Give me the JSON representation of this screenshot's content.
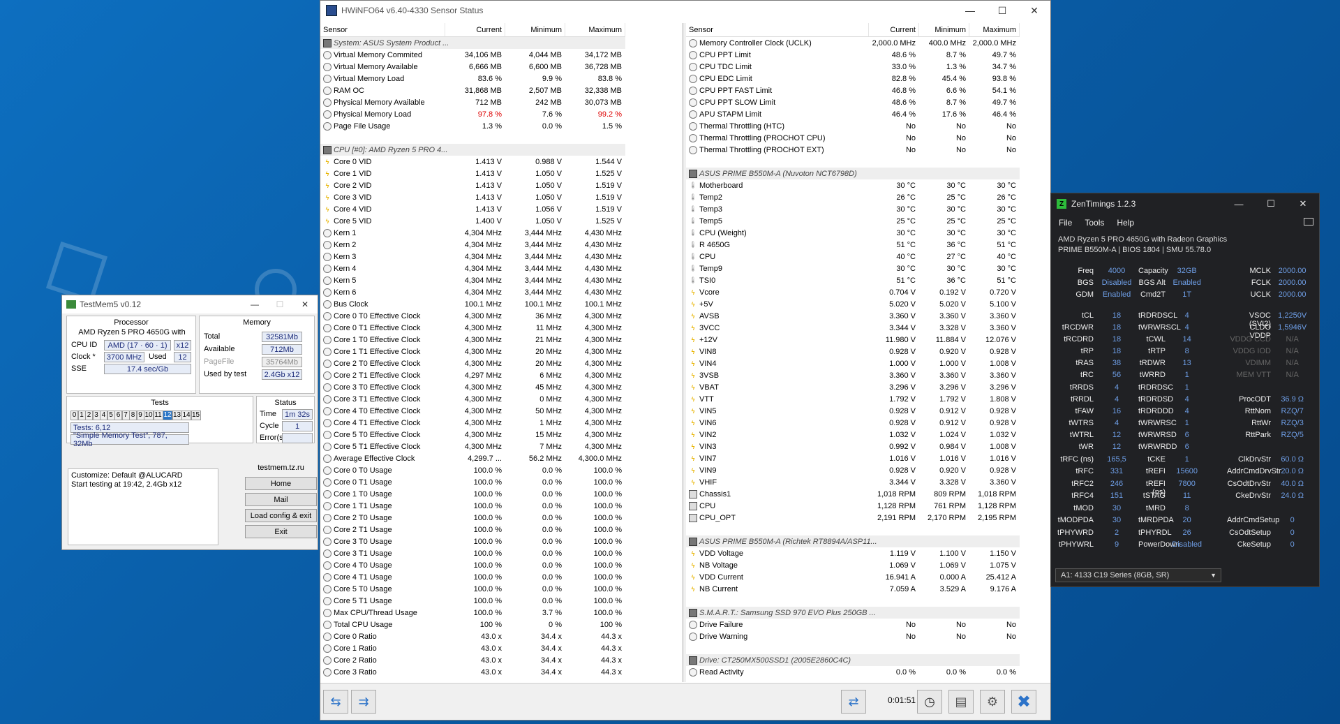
{
  "hwinfo": {
    "title": "HWiNFO64 v6.40-4330 Sensor Status",
    "headers": [
      "Sensor",
      "Current",
      "Minimum",
      "Maximum"
    ],
    "timer": "0:01:51",
    "left_rows": [
      {
        "t": "group",
        "n": "System: ASUS System Product ..."
      },
      {
        "i": "circle",
        "n": "Virtual Memory Commited",
        "c": "34,106 MB",
        "mi": "4,044 MB",
        "ma": "34,172 MB"
      },
      {
        "i": "circle",
        "n": "Virtual Memory Available",
        "c": "6,666 MB",
        "mi": "6,600 MB",
        "ma": "36,728 MB"
      },
      {
        "i": "circle",
        "n": "Virtual Memory Load",
        "c": "83.6 %",
        "mi": "9.9 %",
        "ma": "83.8 %"
      },
      {
        "i": "circle",
        "n": " RAM  OC",
        "c": "31,868 MB",
        "mi": "2,507 MB",
        "ma": "32,338 MB"
      },
      {
        "i": "circle",
        "n": "Physical Memory Available",
        "c": "712 MB",
        "mi": "242 MB",
        "ma": "30,073 MB"
      },
      {
        "i": "circle",
        "n": "Physical Memory Load",
        "c": "97.8 %",
        "mi": "7.6 %",
        "ma": "99.2 %",
        "red": true
      },
      {
        "i": "circle",
        "n": "Page File Usage",
        "c": "1.3 %",
        "mi": "0.0 %",
        "ma": "1.5 %"
      },
      {
        "t": "blank"
      },
      {
        "t": "group",
        "n": "CPU [#0]: AMD Ryzen 5 PRO 4..."
      },
      {
        "i": "bolt",
        "n": "Core 0 VID",
        "c": "1.413 V",
        "mi": "0.988 V",
        "ma": "1.544 V"
      },
      {
        "i": "bolt",
        "n": "Core 1 VID",
        "c": "1.413 V",
        "mi": "1.050 V",
        "ma": "1.525 V"
      },
      {
        "i": "bolt",
        "n": "Core 2 VID",
        "c": "1.413 V",
        "mi": "1.050 V",
        "ma": "1.519 V"
      },
      {
        "i": "bolt",
        "n": "Core 3 VID",
        "c": "1.413 V",
        "mi": "1.050 V",
        "ma": "1.519 V"
      },
      {
        "i": "bolt",
        "n": "Core 4 VID",
        "c": "1.413 V",
        "mi": "1.056 V",
        "ma": "1.519 V"
      },
      {
        "i": "bolt",
        "n": "Core 5 VID",
        "c": "1.400 V",
        "mi": "1.050 V",
        "ma": "1.525 V"
      },
      {
        "i": "circle",
        "n": "Kern 1",
        "c": "4,304 MHz",
        "mi": "3,444 MHz",
        "ma": "4,430 MHz"
      },
      {
        "i": "circle",
        "n": "Kern 2",
        "c": "4,304 MHz",
        "mi": "3,444 MHz",
        "ma": "4,430 MHz"
      },
      {
        "i": "circle",
        "n": "Kern 3",
        "c": "4,304 MHz",
        "mi": "3,444 MHz",
        "ma": "4,430 MHz"
      },
      {
        "i": "circle",
        "n": "Kern 4",
        "c": "4,304 MHz",
        "mi": "3,444 MHz",
        "ma": "4,430 MHz"
      },
      {
        "i": "circle",
        "n": "Kern 5",
        "c": "4,304 MHz",
        "mi": "3,444 MHz",
        "ma": "4,430 MHz"
      },
      {
        "i": "circle",
        "n": "Kern 6",
        "c": "4,304 MHz",
        "mi": "3,444 MHz",
        "ma": "4,430 MHz"
      },
      {
        "i": "circle",
        "n": "Bus Clock",
        "c": "100.1 MHz",
        "mi": "100.1 MHz",
        "ma": "100.1 MHz"
      },
      {
        "i": "circle",
        "n": "Core 0 T0 Effective Clock",
        "c": "4,300 MHz",
        "mi": "36 MHz",
        "ma": "4,300 MHz"
      },
      {
        "i": "circle",
        "n": "Core 0 T1 Effective Clock",
        "c": "4,300 MHz",
        "mi": "11 MHz",
        "ma": "4,300 MHz"
      },
      {
        "i": "circle",
        "n": "Core 1 T0 Effective Clock",
        "c": "4,300 MHz",
        "mi": "21 MHz",
        "ma": "4,300 MHz"
      },
      {
        "i": "circle",
        "n": "Core 1 T1 Effective Clock",
        "c": "4,300 MHz",
        "mi": "20 MHz",
        "ma": "4,300 MHz"
      },
      {
        "i": "circle",
        "n": "Core 2 T0 Effective Clock",
        "c": "4,300 MHz",
        "mi": "20 MHz",
        "ma": "4,300 MHz"
      },
      {
        "i": "circle",
        "n": "Core 2 T1 Effective Clock",
        "c": "4,297 MHz",
        "mi": "6 MHz",
        "ma": "4,300 MHz"
      },
      {
        "i": "circle",
        "n": "Core 3 T0 Effective Clock",
        "c": "4,300 MHz",
        "mi": "45 MHz",
        "ma": "4,300 MHz"
      },
      {
        "i": "circle",
        "n": "Core 3 T1 Effective Clock",
        "c": "4,300 MHz",
        "mi": "0 MHz",
        "ma": "4,300 MHz"
      },
      {
        "i": "circle",
        "n": "Core 4 T0 Effective Clock",
        "c": "4,300 MHz",
        "mi": "50 MHz",
        "ma": "4,300 MHz"
      },
      {
        "i": "circle",
        "n": "Core 4 T1 Effective Clock",
        "c": "4,300 MHz",
        "mi": "1 MHz",
        "ma": "4,300 MHz"
      },
      {
        "i": "circle",
        "n": "Core 5 T0 Effective Clock",
        "c": "4,300 MHz",
        "mi": "15 MHz",
        "ma": "4,300 MHz"
      },
      {
        "i": "circle",
        "n": "Core 5 T1 Effective Clock",
        "c": "4,300 MHz",
        "mi": "7 MHz",
        "ma": "4,300 MHz"
      },
      {
        "i": "circle",
        "n": "Average Effective Clock",
        "c": "4,299.7 ...",
        "mi": "56.2 MHz",
        "ma": "4,300.0 MHz"
      },
      {
        "i": "circle",
        "n": "Core 0 T0 Usage",
        "c": "100.0 %",
        "mi": "0.0 %",
        "ma": "100.0 %"
      },
      {
        "i": "circle",
        "n": "Core 0 T1 Usage",
        "c": "100.0 %",
        "mi": "0.0 %",
        "ma": "100.0 %"
      },
      {
        "i": "circle",
        "n": "Core 1 T0 Usage",
        "c": "100.0 %",
        "mi": "0.0 %",
        "ma": "100.0 %"
      },
      {
        "i": "circle",
        "n": "Core 1 T1 Usage",
        "c": "100.0 %",
        "mi": "0.0 %",
        "ma": "100.0 %"
      },
      {
        "i": "circle",
        "n": "Core 2 T0 Usage",
        "c": "100.0 %",
        "mi": "0.0 %",
        "ma": "100.0 %"
      },
      {
        "i": "circle",
        "n": "Core 2 T1 Usage",
        "c": "100.0 %",
        "mi": "0.0 %",
        "ma": "100.0 %"
      },
      {
        "i": "circle",
        "n": "Core 3 T0 Usage",
        "c": "100.0 %",
        "mi": "0.0 %",
        "ma": "100.0 %"
      },
      {
        "i": "circle",
        "n": "Core 3 T1 Usage",
        "c": "100.0 %",
        "mi": "0.0 %",
        "ma": "100.0 %"
      },
      {
        "i": "circle",
        "n": "Core 4 T0 Usage",
        "c": "100.0 %",
        "mi": "0.0 %",
        "ma": "100.0 %"
      },
      {
        "i": "circle",
        "n": "Core 4 T1 Usage",
        "c": "100.0 %",
        "mi": "0.0 %",
        "ma": "100.0 %"
      },
      {
        "i": "circle",
        "n": "Core 5 T0 Usage",
        "c": "100.0 %",
        "mi": "0.0 %",
        "ma": "100.0 %"
      },
      {
        "i": "circle",
        "n": "Core 5 T1 Usage",
        "c": "100.0 %",
        "mi": "0.0 %",
        "ma": "100.0 %"
      },
      {
        "i": "circle",
        "n": "Max CPU/Thread Usage",
        "c": "100.0 %",
        "mi": "3.7 %",
        "ma": "100.0 %"
      },
      {
        "i": "circle",
        "n": "Total CPU Usage",
        "c": "100 %",
        "mi": "0 %",
        "ma": "100 %"
      },
      {
        "i": "circle",
        "n": "Core 0 Ratio",
        "c": "43.0 x",
        "mi": "34.4 x",
        "ma": "44.3 x"
      },
      {
        "i": "circle",
        "n": "Core 1 Ratio",
        "c": "43.0 x",
        "mi": "34.4 x",
        "ma": "44.3 x"
      },
      {
        "i": "circle",
        "n": "Core 2 Ratio",
        "c": "43.0 x",
        "mi": "34.4 x",
        "ma": "44.3 x"
      },
      {
        "i": "circle",
        "n": "Core 3 Ratio",
        "c": "43.0 x",
        "mi": "34.4 x",
        "ma": "44.3 x"
      }
    ],
    "right_rows": [
      {
        "i": "circle",
        "n": "Memory Controller Clock (UCLK)",
        "c": "2,000.0 MHz",
        "mi": "400.0 MHz",
        "ma": "2,000.0 MHz"
      },
      {
        "i": "circle",
        "n": "CPU PPT Limit",
        "c": "48.6 %",
        "mi": "8.7 %",
        "ma": "49.7 %"
      },
      {
        "i": "circle",
        "n": "CPU TDC Limit",
        "c": "33.0 %",
        "mi": "1.3 %",
        "ma": "34.7 %"
      },
      {
        "i": "circle",
        "n": "CPU EDC Limit",
        "c": "82.8 %",
        "mi": "45.4 %",
        "ma": "93.8 %"
      },
      {
        "i": "circle",
        "n": "CPU PPT FAST Limit",
        "c": "46.8 %",
        "mi": "6.6 %",
        "ma": "54.1 %"
      },
      {
        "i": "circle",
        "n": "CPU PPT SLOW Limit",
        "c": "48.6 %",
        "mi": "8.7 %",
        "ma": "49.7 %"
      },
      {
        "i": "circle",
        "n": "APU STAPM Limit",
        "c": "46.4 %",
        "mi": "17.6 %",
        "ma": "46.4 %"
      },
      {
        "i": "circle",
        "n": "Thermal Throttling (HTC)",
        "c": "No",
        "mi": "No",
        "ma": "No"
      },
      {
        "i": "circle",
        "n": "Thermal Throttling (PROCHOT CPU)",
        "c": "No",
        "mi": "No",
        "ma": "No"
      },
      {
        "i": "circle",
        "n": "Thermal Throttling (PROCHOT EXT)",
        "c": "No",
        "mi": "No",
        "ma": "No"
      },
      {
        "t": "blank"
      },
      {
        "t": "group",
        "n": "ASUS PRIME B550M-A (Nuvoton NCT6798D)"
      },
      {
        "i": "therm",
        "n": "Motherboard",
        "c": "30 °C",
        "mi": "30 °C",
        "ma": "30 °C"
      },
      {
        "i": "therm",
        "n": "Temp2",
        "c": "26 °C",
        "mi": "25 °C",
        "ma": "26 °C"
      },
      {
        "i": "therm",
        "n": "Temp3",
        "c": "30 °C",
        "mi": "30 °C",
        "ma": "30 °C"
      },
      {
        "i": "therm",
        "n": "Temp5",
        "c": "25 °C",
        "mi": "25 °C",
        "ma": "25 °C"
      },
      {
        "i": "therm",
        "n": "CPU (Weight)",
        "c": "30 °C",
        "mi": "30 °C",
        "ma": "30 °C"
      },
      {
        "i": "therm",
        "n": " R 4650G",
        "c": "51 °C",
        "mi": "36 °C",
        "ma": "51 °C"
      },
      {
        "i": "therm",
        "n": "CPU",
        "c": "40 °C",
        "mi": "27 °C",
        "ma": "40 °C"
      },
      {
        "i": "therm",
        "n": "Temp9",
        "c": "30 °C",
        "mi": "30 °C",
        "ma": "30 °C"
      },
      {
        "i": "therm",
        "n": "TSI0",
        "c": "51 °C",
        "mi": "36 °C",
        "ma": "51 °C"
      },
      {
        "i": "bolt",
        "n": "Vcore",
        "c": "0.704 V",
        "mi": "0.192 V",
        "ma": "0.720 V"
      },
      {
        "i": "bolt",
        "n": "+5V",
        "c": "5.020 V",
        "mi": "5.020 V",
        "ma": "5.100 V"
      },
      {
        "i": "bolt",
        "n": "AVSB",
        "c": "3.360 V",
        "mi": "3.360 V",
        "ma": "3.360 V"
      },
      {
        "i": "bolt",
        "n": "3VCC",
        "c": "3.344 V",
        "mi": "3.328 V",
        "ma": "3.360 V"
      },
      {
        "i": "bolt",
        "n": "+12V",
        "c": "11.980 V",
        "mi": "11.884 V",
        "ma": "12.076 V"
      },
      {
        "i": "bolt",
        "n": "VIN8",
        "c": "0.928 V",
        "mi": "0.920 V",
        "ma": "0.928 V"
      },
      {
        "i": "bolt",
        "n": "VIN4",
        "c": "1.000 V",
        "mi": "1.000 V",
        "ma": "1.008 V"
      },
      {
        "i": "bolt",
        "n": "3VSB",
        "c": "3.360 V",
        "mi": "3.360 V",
        "ma": "3.360 V"
      },
      {
        "i": "bolt",
        "n": "VBAT",
        "c": "3.296 V",
        "mi": "3.296 V",
        "ma": "3.296 V"
      },
      {
        "i": "bolt",
        "n": "VTT",
        "c": "1.792 V",
        "mi": "1.792 V",
        "ma": "1.808 V"
      },
      {
        "i": "bolt",
        "n": "VIN5",
        "c": "0.928 V",
        "mi": "0.912 V",
        "ma": "0.928 V"
      },
      {
        "i": "bolt",
        "n": "VIN6",
        "c": "0.928 V",
        "mi": "0.912 V",
        "ma": "0.928 V"
      },
      {
        "i": "bolt",
        "n": "VIN2",
        "c": "1.032 V",
        "mi": "1.024 V",
        "ma": "1.032 V"
      },
      {
        "i": "bolt",
        "n": "VIN3",
        "c": "0.992 V",
        "mi": "0.984 V",
        "ma": "1.008 V"
      },
      {
        "i": "bolt",
        "n": "VIN7",
        "c": "1.016 V",
        "mi": "1.016 V",
        "ma": "1.016 V"
      },
      {
        "i": "bolt",
        "n": "VIN9",
        "c": "0.928 V",
        "mi": "0.920 V",
        "ma": "0.928 V"
      },
      {
        "i": "bolt",
        "n": "VHIF",
        "c": "3.344 V",
        "mi": "3.328 V",
        "ma": "3.360 V"
      },
      {
        "i": "fan",
        "n": "Chassis1",
        "c": "1,018 RPM",
        "mi": "809 RPM",
        "ma": "1,018 RPM"
      },
      {
        "i": "fan",
        "n": "CPU",
        "c": "1,128 RPM",
        "mi": "761 RPM",
        "ma": "1,128 RPM"
      },
      {
        "i": "fan",
        "n": "CPU_OPT",
        "c": "2,191 RPM",
        "mi": "2,170 RPM",
        "ma": "2,195 RPM"
      },
      {
        "t": "blank"
      },
      {
        "t": "group",
        "n": "ASUS PRIME B550M-A (Richtek RT8894A/ASP11..."
      },
      {
        "i": "bolt",
        "n": "VDD Voltage",
        "c": "1.119 V",
        "mi": "1.100 V",
        "ma": "1.150 V"
      },
      {
        "i": "bolt",
        "n": "NB Voltage",
        "c": "1.069 V",
        "mi": "1.069 V",
        "ma": "1.075 V"
      },
      {
        "i": "bolt",
        "n": "VDD Current",
        "c": "16.941 A",
        "mi": "0.000 A",
        "ma": "25.412 A"
      },
      {
        "i": "bolt",
        "n": "NB Current",
        "c": "7.059 A",
        "mi": "3.529 A",
        "ma": "9.176 A"
      },
      {
        "t": "blank"
      },
      {
        "t": "group",
        "n": "S.M.A.R.T.: Samsung SSD 970 EVO Plus 250GB ..."
      },
      {
        "i": "circle",
        "n": "Drive Failure",
        "c": "No",
        "mi": "No",
        "ma": "No"
      },
      {
        "i": "circle",
        "n": "Drive Warning",
        "c": "No",
        "mi": "No",
        "ma": "No"
      },
      {
        "t": "blank"
      },
      {
        "t": "group",
        "n": "Drive: CT250MX500SSD1 (2005E2860C4C)"
      },
      {
        "i": "circle",
        "n": "Read Activity",
        "c": "0.0 %",
        "mi": "0.0 %",
        "ma": "0.0 %"
      }
    ]
  },
  "testmem": {
    "title": "TestMem5 v0.12",
    "processor_title": "Processor",
    "cpu_name": "AMD Ryzen 5 PRO 4650G with",
    "cpu_id_label": "CPU ID",
    "cpu_id": "AMD  (17 · 60 · 1)",
    "cpu_id_x": "x12",
    "clock_label": "Clock *",
    "clock": "3700 MHz",
    "used_label": "Used",
    "used": "12",
    "sse_label": "SSE",
    "sse": "17.4 sec/Gb",
    "memory_title": "Memory",
    "total_label": "Total",
    "total": "32581Mb",
    "avail_label": "Available",
    "avail": "712Mb",
    "pagefile_label": "PageFile",
    "pagefile": "35764Mb",
    "usedby_label": "Used by test",
    "usedby": "2.4Gb x12",
    "tests_title": "Tests",
    "test_numbers": [
      "0",
      "1",
      "2",
      "3",
      "4",
      "5",
      "6",
      "7",
      "8",
      "9",
      "10",
      "11",
      "12",
      "13",
      "14",
      "15"
    ],
    "tests_line": "Tests: 6,12",
    "tests_desc": "\"Simple Memory Test\", 787, 32Mb",
    "status_title": "Status",
    "time_label": "Time",
    "time": "1m 32s",
    "cycle_label": "Cycle",
    "cycle": "1",
    "errors_label": "Error(s)",
    "errors": "",
    "log": [
      "Customize: Default @ALUCARD",
      "Start testing at 19:42, 2.4Gb x12"
    ],
    "site": "testmem.tz.ru",
    "btn_home": "Home",
    "btn_mail": "Mail",
    "btn_load": "Load config & exit",
    "btn_exit": "Exit"
  },
  "zen": {
    "title": "ZenTimings 1.2.3",
    "menu": [
      "File",
      "Tools",
      "Help"
    ],
    "cpu": "AMD Ryzen 5 PRO 4650G with Radeon Graphics",
    "board": "PRIME B550M-A | BIOS 1804 | SMU 55.78.0",
    "col1": [
      [
        "Freq",
        "4000"
      ],
      [
        "BGS",
        "Disabled"
      ],
      [
        "GDM",
        "Enabled"
      ],
      [
        "",
        ""
      ],
      [
        "tCL",
        "18"
      ],
      [
        "tRCDWR",
        "18"
      ],
      [
        "tRCDRD",
        "18"
      ],
      [
        "tRP",
        "18"
      ],
      [
        "tRAS",
        "38"
      ],
      [
        "tRC",
        "56"
      ],
      [
        "tRRDS",
        "4"
      ],
      [
        "tRRDL",
        "4"
      ],
      [
        "tFAW",
        "16"
      ],
      [
        "tWTRS",
        "4"
      ],
      [
        "tWTRL",
        "12"
      ],
      [
        "tWR",
        "12"
      ],
      [
        "tRFC (ns)",
        "165,5"
      ],
      [
        "tRFC",
        "331"
      ],
      [
        "tRFC2",
        "246"
      ],
      [
        "tRFC4",
        "151"
      ],
      [
        "tMOD",
        "30"
      ],
      [
        "tMODPDA",
        "30"
      ],
      [
        "tPHYWRD",
        "2"
      ],
      [
        "tPHYWRL",
        "9"
      ]
    ],
    "col2": [
      [
        "Capacity",
        "32GB"
      ],
      [
        "BGS Alt",
        "Enabled"
      ],
      [
        "Cmd2T",
        "1T"
      ],
      [
        "",
        ""
      ],
      [
        "tRDRDSCL",
        "4"
      ],
      [
        "tWRWRSCL",
        "4"
      ],
      [
        "tCWL",
        "14"
      ],
      [
        "tRTP",
        "8"
      ],
      [
        "tRDWR",
        "13"
      ],
      [
        "tWRRD",
        "1"
      ],
      [
        "tRDRDSC",
        "1"
      ],
      [
        "tRDRDSD",
        "4"
      ],
      [
        "tRDRDDD",
        "4"
      ],
      [
        "tWRWRSC",
        "1"
      ],
      [
        "tWRWRSD",
        "6"
      ],
      [
        "tWRWRDD",
        "6"
      ],
      [
        "tCKE",
        "1"
      ],
      [
        "tREFI",
        "15600"
      ],
      [
        "tREFI (ns)",
        "7800"
      ],
      [
        "tSTAG",
        "11"
      ],
      [
        "tMRD",
        "8"
      ],
      [
        "tMRDPDA",
        "20"
      ],
      [
        "tPHYRDL",
        "26"
      ],
      [
        "PowerDown",
        "Disabled"
      ]
    ],
    "col3": [
      [
        "MCLK",
        "2000.00"
      ],
      [
        "FCLK",
        "2000.00"
      ],
      [
        "UCLK",
        "2000.00"
      ],
      [
        "",
        ""
      ],
      [
        "VSOC (SVI2)",
        "1,2250V"
      ],
      [
        "CLDO VDDP",
        "1,5946V"
      ],
      [
        "VDDG CCD",
        "N/A"
      ],
      [
        "VDDG IOD",
        "N/A"
      ],
      [
        "VDIMM",
        "N/A"
      ],
      [
        "MEM VTT",
        "N/A"
      ],
      [
        "",
        ""
      ],
      [
        "ProcODT",
        "36.9 Ω"
      ],
      [
        "RttNom",
        "RZQ/7"
      ],
      [
        "RttWr",
        "RZQ/3"
      ],
      [
        "RttPark",
        "RZQ/5"
      ],
      [
        "",
        ""
      ],
      [
        "ClkDrvStr",
        "60.0 Ω"
      ],
      [
        "AddrCmdDrvStr",
        "20.0 Ω"
      ],
      [
        "CsOdtDrvStr",
        "40.0 Ω"
      ],
      [
        "CkeDrvStr",
        "24.0 Ω"
      ],
      [
        "",
        ""
      ],
      [
        "AddrCmdSetup",
        "0"
      ],
      [
        "CsOdtSetup",
        "0"
      ],
      [
        "CkeSetup",
        "0"
      ]
    ],
    "profile": "A1: 4133 C19 Series (8GB, SR)"
  }
}
